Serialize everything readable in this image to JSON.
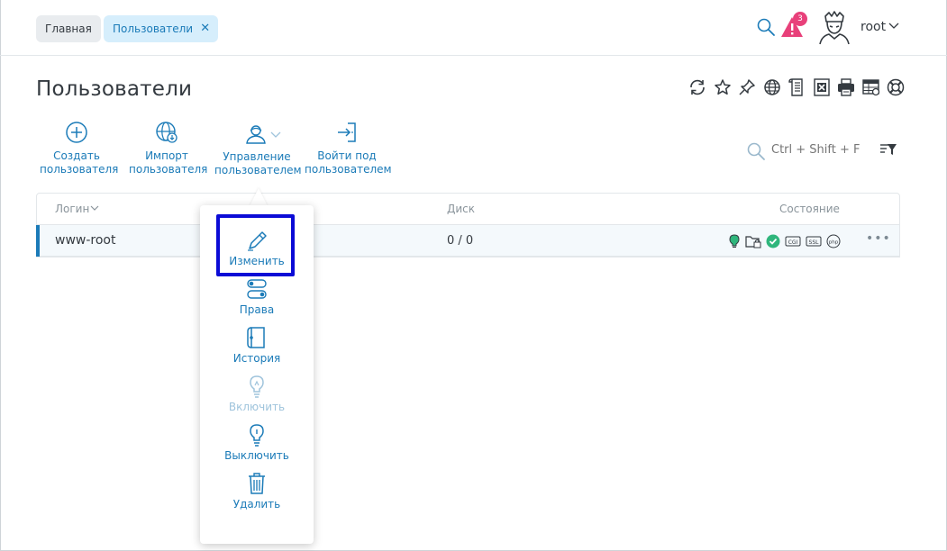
{
  "breadcrumbs": [
    {
      "label": "Главная"
    },
    {
      "label": "Пользователи",
      "active": true
    }
  ],
  "header": {
    "alert_count": "3",
    "user_name": "root"
  },
  "page": {
    "title": "Пользователи"
  },
  "toolbar_icons": [
    "refresh-icon",
    "star-icon",
    "pin-icon",
    "globe-icon",
    "document-icon",
    "excel-icon",
    "print-icon",
    "settings-table-icon",
    "help-icon"
  ],
  "actions": {
    "create": {
      "line1": "Создать",
      "line2": "пользователя"
    },
    "import": {
      "line1": "Импорт",
      "line2": "пользователя"
    },
    "manage": {
      "line1": "Управление",
      "line2": "пользователем"
    },
    "login_as": {
      "line1": "Войти под",
      "line2": "пользователем"
    }
  },
  "filter": {
    "placeholder": "Ctrl + Shift + F"
  },
  "table": {
    "columns": {
      "login": "Логин",
      "disk": "Диск",
      "state": "Состояние"
    },
    "rows": [
      {
        "login": "www-root",
        "disk": "0 / 0",
        "status_icons": [
          "bulb-icon",
          "folder-lock-icon",
          "check-icon",
          "cgi-icon",
          "ssl-icon",
          "php-icon"
        ]
      }
    ]
  },
  "context_menu": {
    "items": [
      {
        "label": "Изменить",
        "enabled": true,
        "icon": "pencil-icon"
      },
      {
        "label": "Права",
        "enabled": true,
        "icon": "rights-icon"
      },
      {
        "label": "История",
        "enabled": true,
        "icon": "history-icon"
      },
      {
        "label": "Включить",
        "enabled": false,
        "icon": "bulb-on-icon"
      },
      {
        "label": "Выключить",
        "enabled": true,
        "icon": "bulb-off-icon"
      },
      {
        "label": "Удалить",
        "enabled": true,
        "icon": "trash-icon"
      }
    ]
  },
  "colors": {
    "accent": "#1b7bb8",
    "alert": "#e8407a",
    "highlight": "#0b0bd6",
    "success": "#2fb67c"
  }
}
